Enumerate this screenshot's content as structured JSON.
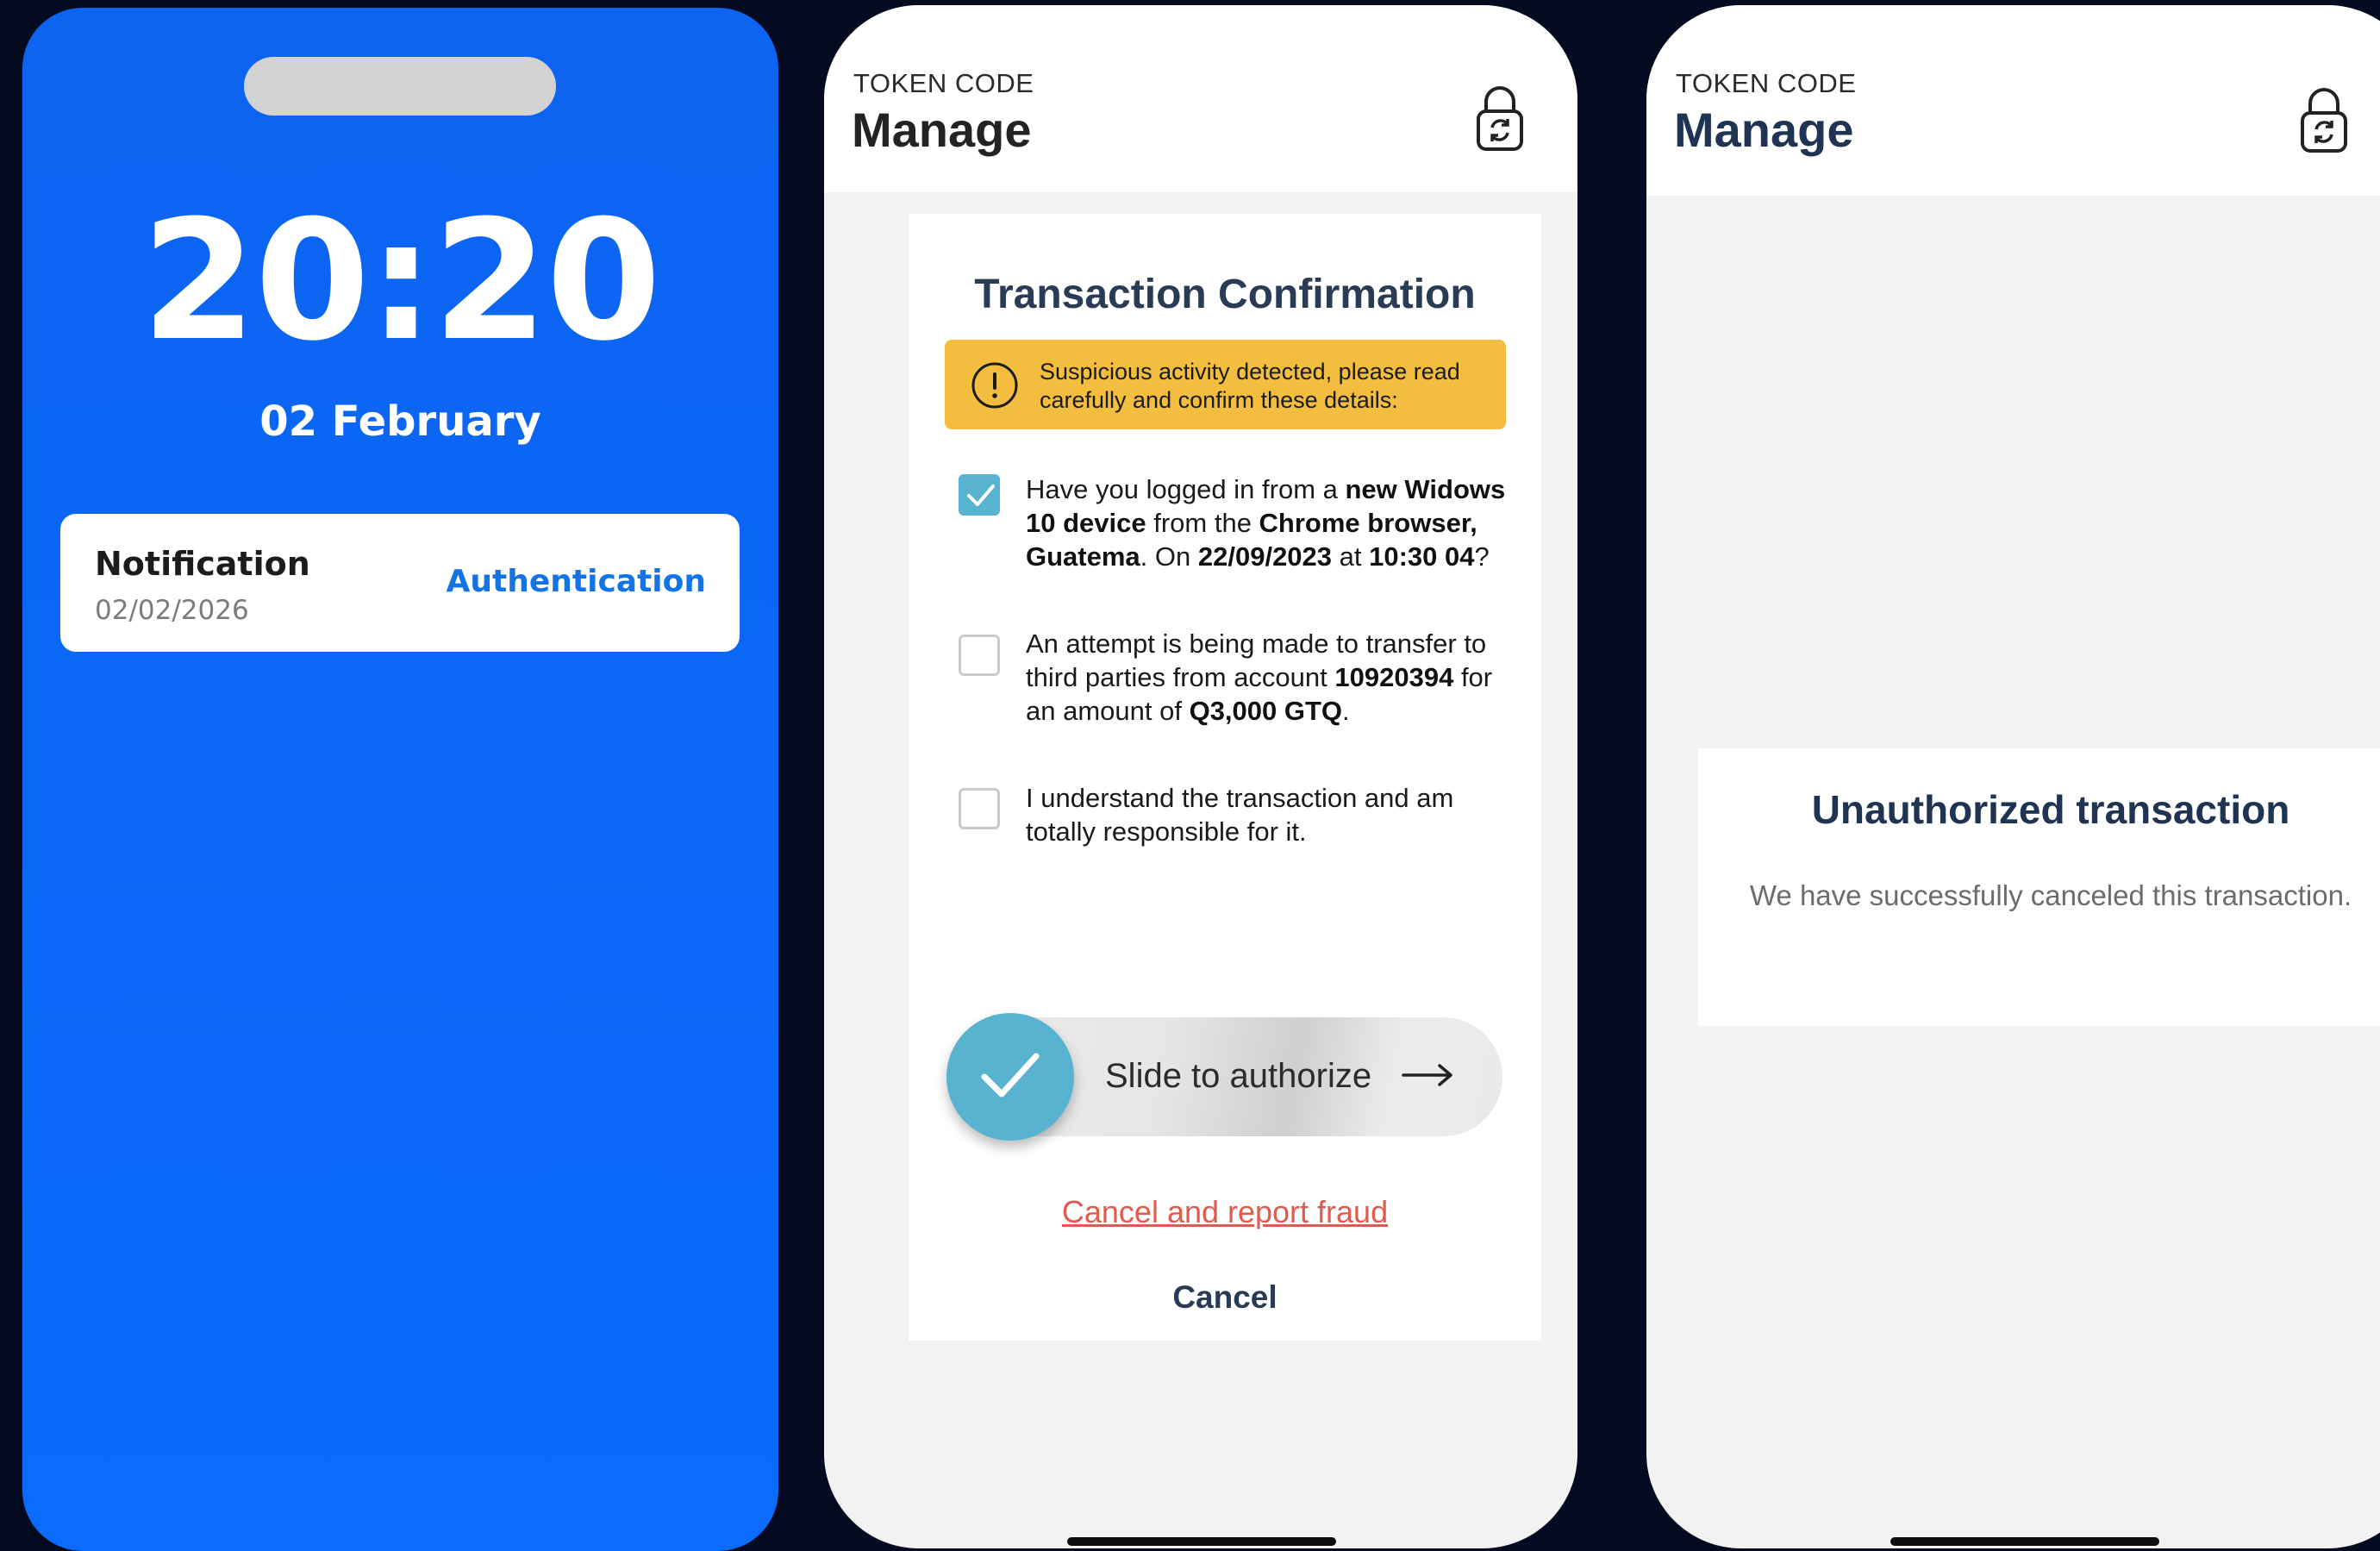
{
  "lock_screen": {
    "time": "20:20",
    "date": "02 February",
    "notification": {
      "title": "Notification",
      "date": "02/02/2026",
      "action": "Authentication"
    }
  },
  "confirm_screen": {
    "header": {
      "kicker": "TOKEN CODE",
      "title": "Manage",
      "lock_icon": "lock-refresh-icon"
    },
    "card_title": "Transaction Confirmation",
    "warning": "Suspicious activity detected, please read carefully and confirm these details:",
    "items": [
      {
        "checked": true,
        "parts": [
          {
            "t": "Have you logged in from a "
          },
          {
            "t": "new Widows 10 device",
            "b": true
          },
          {
            "t": " from the "
          },
          {
            "t": "Chrome browser, Guatema",
            "b": true
          },
          {
            "t": ". On "
          },
          {
            "t": "22/09/2023",
            "b": true
          },
          {
            "t": " at "
          },
          {
            "t": "10:30 04",
            "b": true
          },
          {
            "t": "?"
          }
        ]
      },
      {
        "checked": false,
        "parts": [
          {
            "t": "An attempt is being made to transfer to third parties from account "
          },
          {
            "t": "10920394",
            "b": true
          },
          {
            "t": " for an amount of "
          },
          {
            "t": "Q3,000 GTQ",
            "b": true
          },
          {
            "t": "."
          }
        ]
      },
      {
        "checked": false,
        "parts": [
          {
            "t": "I understand the transaction and am totally responsible for it."
          }
        ]
      }
    ],
    "slide_label": "Slide to authorize",
    "report_link": "Cancel and report fraud",
    "cancel_label": "Cancel",
    "colors": {
      "accent": "#57b3d0",
      "warning": "#f3be3f",
      "danger": "#e05a4f",
      "navy": "#2a3b55"
    }
  },
  "result_screen": {
    "header": {
      "kicker": "TOKEN CODE",
      "title": "Manage",
      "lock_icon": "lock-refresh-icon"
    },
    "title": "Unauthorized transaction",
    "message": "We have successfully canceled this transaction."
  }
}
